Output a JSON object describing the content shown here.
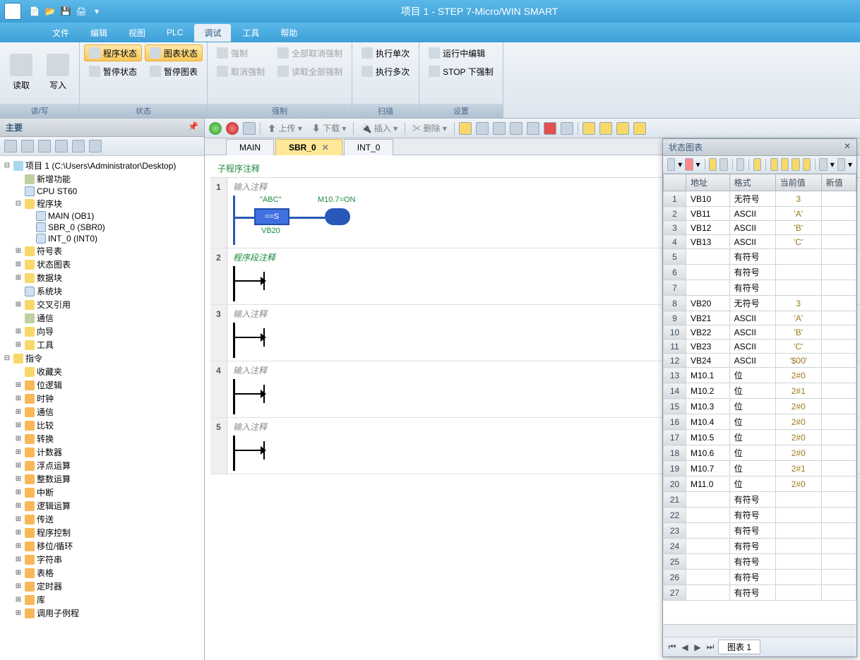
{
  "titlebar": {
    "title": "项目 1 - STEP 7-Micro/WIN SMART"
  },
  "menubar": {
    "items": [
      "文件",
      "编辑",
      "视图",
      "PLC",
      "调试",
      "工具",
      "帮助"
    ],
    "active_index": 4
  },
  "ribbon": {
    "groups": [
      {
        "label": "读/写",
        "big_buttons": [
          {
            "label": "读取"
          },
          {
            "label": "写入"
          }
        ]
      },
      {
        "label": "状态",
        "small_rows": [
          [
            "程序状态",
            "图表状态"
          ],
          [
            "暂停状态",
            "暂停图表"
          ]
        ],
        "highlight": [
          0,
          1
        ]
      },
      {
        "label": "强制",
        "small_rows": [
          [
            "强制",
            "全部取消强制"
          ],
          [
            "取消强制",
            "读取全部强制"
          ]
        ],
        "disabled": true
      },
      {
        "label": "扫描",
        "small_rows": [
          [
            "执行单次"
          ],
          [
            "执行多次"
          ]
        ]
      },
      {
        "label": "设置",
        "small_rows": [
          [
            "运行中编辑"
          ],
          [
            "STOP 下强制"
          ]
        ]
      }
    ]
  },
  "left_panel": {
    "title": "主要",
    "tree": [
      {
        "d": 0,
        "t": "minus",
        "i": "project",
        "l": "项目 1 (C:\\Users\\Administrator\\Desktop)"
      },
      {
        "d": 1,
        "t": "",
        "i": "misc",
        "l": "新增功能"
      },
      {
        "d": 1,
        "t": "",
        "i": "file",
        "l": "CPU ST60"
      },
      {
        "d": 1,
        "t": "minus",
        "i": "folder",
        "l": "程序块"
      },
      {
        "d": 2,
        "t": "",
        "i": "file",
        "l": "MAIN (OB1)"
      },
      {
        "d": 2,
        "t": "",
        "i": "file",
        "l": "SBR_0 (SBR0)"
      },
      {
        "d": 2,
        "t": "",
        "i": "file",
        "l": "INT_0 (INT0)"
      },
      {
        "d": 1,
        "t": "plus",
        "i": "folder",
        "l": "符号表"
      },
      {
        "d": 1,
        "t": "plus",
        "i": "folder",
        "l": "状态图表"
      },
      {
        "d": 1,
        "t": "plus",
        "i": "folder",
        "l": "数据块"
      },
      {
        "d": 1,
        "t": "",
        "i": "file",
        "l": "系统块"
      },
      {
        "d": 1,
        "t": "plus",
        "i": "folder",
        "l": "交叉引用"
      },
      {
        "d": 1,
        "t": "",
        "i": "misc",
        "l": "通信"
      },
      {
        "d": 1,
        "t": "plus",
        "i": "folder",
        "l": "向导"
      },
      {
        "d": 1,
        "t": "plus",
        "i": "folder",
        "l": "工具"
      },
      {
        "d": 0,
        "t": "minus",
        "i": "folder",
        "l": "指令"
      },
      {
        "d": 1,
        "t": "",
        "i": "folder",
        "l": "收藏夹"
      },
      {
        "d": 1,
        "t": "plus",
        "i": "orange",
        "l": "位逻辑"
      },
      {
        "d": 1,
        "t": "plus",
        "i": "orange",
        "l": "时钟"
      },
      {
        "d": 1,
        "t": "plus",
        "i": "orange",
        "l": "通信"
      },
      {
        "d": 1,
        "t": "plus",
        "i": "orange",
        "l": "比较"
      },
      {
        "d": 1,
        "t": "plus",
        "i": "orange",
        "l": "转换"
      },
      {
        "d": 1,
        "t": "plus",
        "i": "orange",
        "l": "计数器"
      },
      {
        "d": 1,
        "t": "plus",
        "i": "orange",
        "l": "浮点运算"
      },
      {
        "d": 1,
        "t": "plus",
        "i": "orange",
        "l": "整数运算"
      },
      {
        "d": 1,
        "t": "plus",
        "i": "orange",
        "l": "中断"
      },
      {
        "d": 1,
        "t": "plus",
        "i": "orange",
        "l": "逻辑运算"
      },
      {
        "d": 1,
        "t": "plus",
        "i": "orange",
        "l": "传送"
      },
      {
        "d": 1,
        "t": "plus",
        "i": "orange",
        "l": "程序控制"
      },
      {
        "d": 1,
        "t": "plus",
        "i": "orange",
        "l": "移位/循环"
      },
      {
        "d": 1,
        "t": "plus",
        "i": "orange",
        "l": "字符串"
      },
      {
        "d": 1,
        "t": "plus",
        "i": "orange",
        "l": "表格"
      },
      {
        "d": 1,
        "t": "plus",
        "i": "orange",
        "l": "定时器"
      },
      {
        "d": 1,
        "t": "plus",
        "i": "orange",
        "l": "库"
      },
      {
        "d": 1,
        "t": "plus",
        "i": "orange",
        "l": "调用子例程"
      }
    ]
  },
  "editor": {
    "tabs": [
      {
        "label": "MAIN"
      },
      {
        "label": "SBR_0",
        "active": true,
        "closable": true
      },
      {
        "label": "INT_0"
      }
    ],
    "toolbar_texts": {
      "upload": "上传",
      "download": "下载",
      "insert": "插入",
      "delete": "删除"
    },
    "subprogram_title": "子程序注释",
    "networks": [
      {
        "num": "1",
        "comment": "输入注释",
        "type": "compare",
        "top_label": "\"ABC\"",
        "op": "==S",
        "bottom_label": "VB20",
        "coil_label": "M10.7=ON"
      },
      {
        "num": "2",
        "comment": "程序段注释",
        "type": "arrow"
      },
      {
        "num": "3",
        "comment": "输入注释",
        "type": "arrow"
      },
      {
        "num": "4",
        "comment": "输入注释",
        "type": "arrow"
      },
      {
        "num": "5",
        "comment": "输入注释",
        "type": "arrow"
      }
    ]
  },
  "status_chart": {
    "title": "状态图表",
    "nav_label": "图表  1",
    "columns": [
      "地址",
      "格式",
      "当前值",
      "新值"
    ],
    "rows": [
      {
        "n": "1",
        "addr": "VB10",
        "fmt": "无符号",
        "val": "3"
      },
      {
        "n": "2",
        "addr": "VB11",
        "fmt": "ASCII",
        "val": "'A'"
      },
      {
        "n": "3",
        "addr": "VB12",
        "fmt": "ASCII",
        "val": "'B'"
      },
      {
        "n": "4",
        "addr": "VB13",
        "fmt": "ASCII",
        "val": "'C'"
      },
      {
        "n": "5",
        "addr": "",
        "fmt": "有符号",
        "val": ""
      },
      {
        "n": "6",
        "addr": "",
        "fmt": "有符号",
        "val": ""
      },
      {
        "n": "7",
        "addr": "",
        "fmt": "有符号",
        "val": ""
      },
      {
        "n": "8",
        "addr": "VB20",
        "fmt": "无符号",
        "val": "3"
      },
      {
        "n": "9",
        "addr": "VB21",
        "fmt": "ASCII",
        "val": "'A'"
      },
      {
        "n": "10",
        "addr": "VB22",
        "fmt": "ASCII",
        "val": "'B'"
      },
      {
        "n": "11",
        "addr": "VB23",
        "fmt": "ASCII",
        "val": "'C'"
      },
      {
        "n": "12",
        "addr": "VB24",
        "fmt": "ASCII",
        "val": "'$00'"
      },
      {
        "n": "13",
        "addr": "M10.1",
        "fmt": "位",
        "val": "2#0"
      },
      {
        "n": "14",
        "addr": "M10.2",
        "fmt": "位",
        "val": "2#1"
      },
      {
        "n": "15",
        "addr": "M10.3",
        "fmt": "位",
        "val": "2#0"
      },
      {
        "n": "16",
        "addr": "M10.4",
        "fmt": "位",
        "val": "2#0"
      },
      {
        "n": "17",
        "addr": "M10.5",
        "fmt": "位",
        "val": "2#0"
      },
      {
        "n": "18",
        "addr": "M10.6",
        "fmt": "位",
        "val": "2#0"
      },
      {
        "n": "19",
        "addr": "M10.7",
        "fmt": "位",
        "val": "2#1"
      },
      {
        "n": "20",
        "addr": "M11.0",
        "fmt": "位",
        "val": "2#0"
      },
      {
        "n": "21",
        "addr": "",
        "fmt": "有符号",
        "val": ""
      },
      {
        "n": "22",
        "addr": "",
        "fmt": "有符号",
        "val": ""
      },
      {
        "n": "23",
        "addr": "",
        "fmt": "有符号",
        "val": ""
      },
      {
        "n": "24",
        "addr": "",
        "fmt": "有符号",
        "val": ""
      },
      {
        "n": "25",
        "addr": "",
        "fmt": "有符号",
        "val": ""
      },
      {
        "n": "26",
        "addr": "",
        "fmt": "有符号",
        "val": ""
      },
      {
        "n": "27",
        "addr": "",
        "fmt": "有符号",
        "val": ""
      }
    ]
  }
}
